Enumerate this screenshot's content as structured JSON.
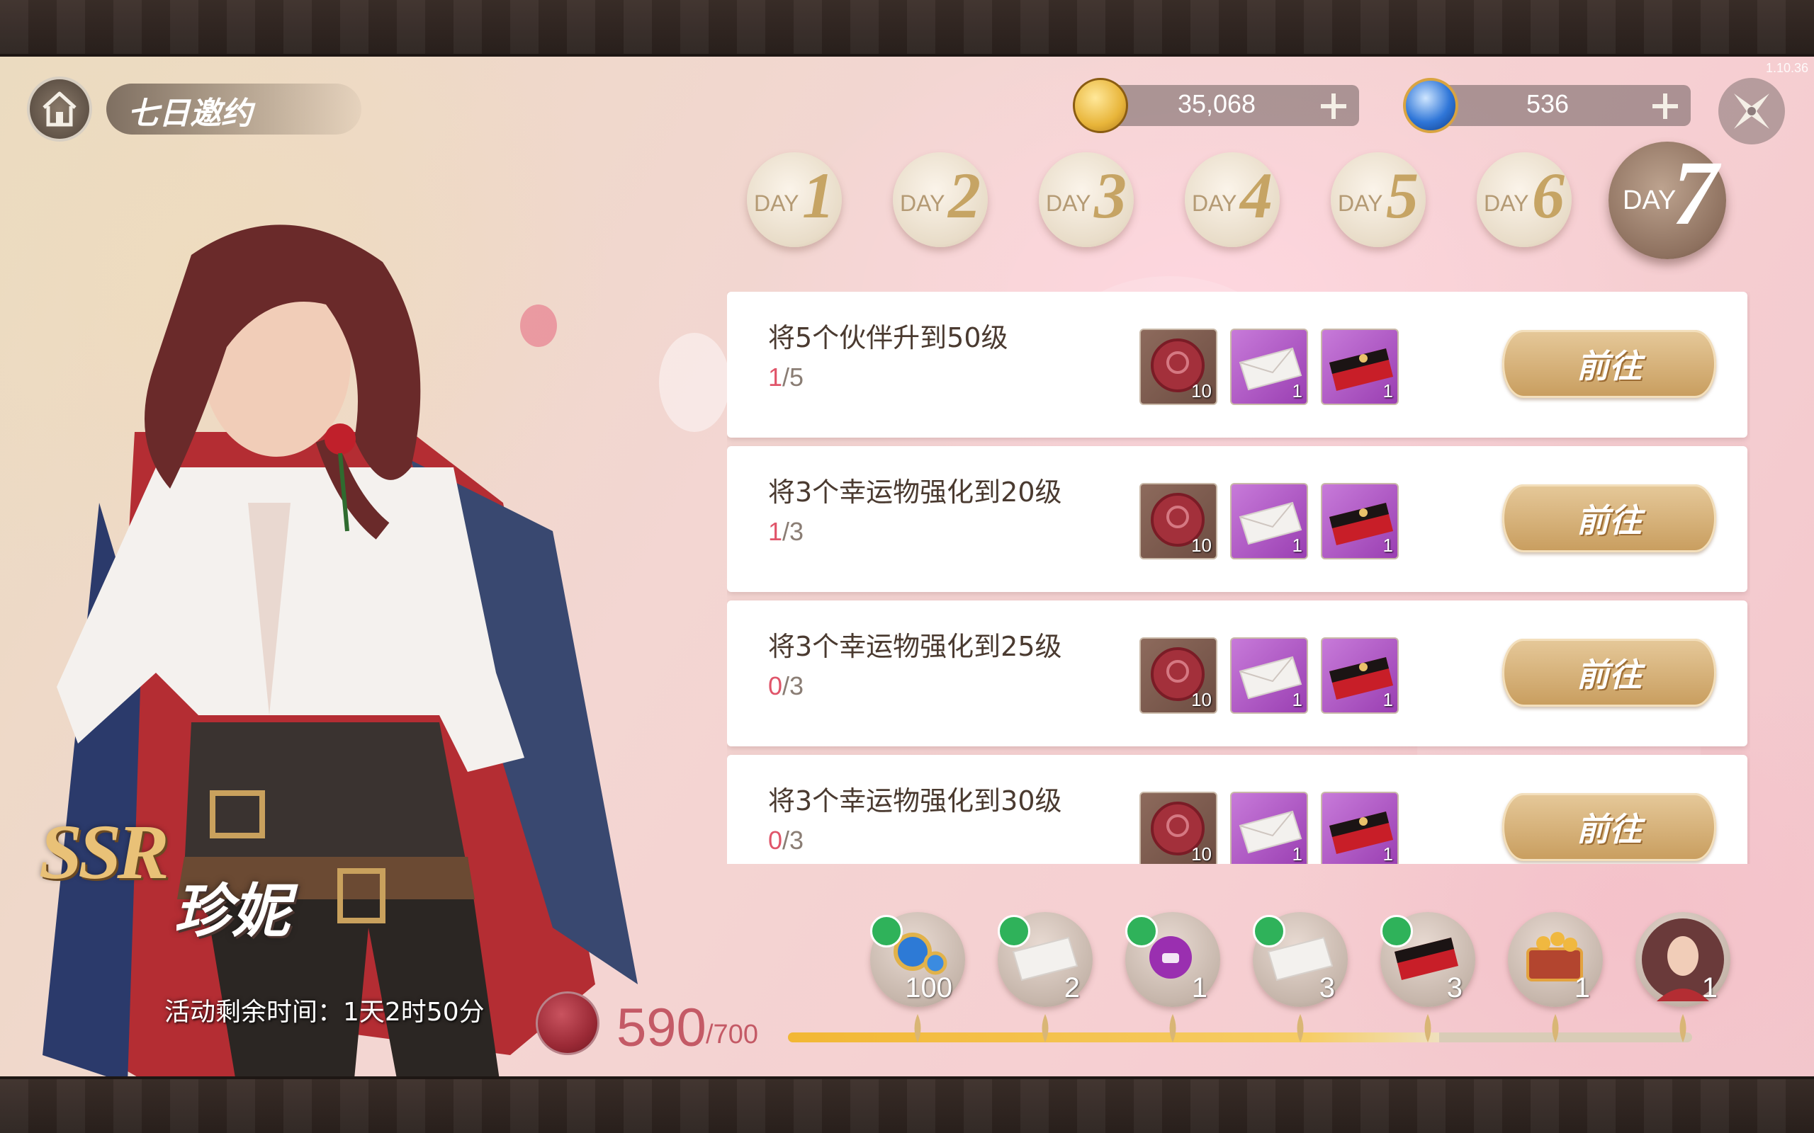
{
  "app": {
    "version": "1.10.36",
    "title": "七日邀约"
  },
  "currencies": [
    {
      "name": "gold-coin",
      "value": "35,068"
    },
    {
      "name": "blue-gem",
      "value": "536"
    }
  ],
  "days": [
    {
      "word": "DAY",
      "num": "1",
      "active": false
    },
    {
      "word": "DAY",
      "num": "2",
      "active": false
    },
    {
      "word": "DAY",
      "num": "3",
      "active": false
    },
    {
      "word": "DAY",
      "num": "4",
      "active": false
    },
    {
      "word": "DAY",
      "num": "5",
      "active": false
    },
    {
      "word": "DAY",
      "num": "6",
      "active": false
    },
    {
      "word": "DAY",
      "num": "7",
      "active": true
    }
  ],
  "tasks": [
    {
      "title": "将5个伙伴升到50级",
      "current": "1",
      "total": "/5",
      "rewards": [
        "10",
        "1",
        "1"
      ],
      "button": "前往"
    },
    {
      "title": "将3个幸运物强化到20级",
      "current": "1",
      "total": "/3",
      "rewards": [
        "10",
        "1",
        "1"
      ],
      "button": "前往"
    },
    {
      "title": "将3个幸运物强化到25级",
      "current": "0",
      "total": "/3",
      "rewards": [
        "10",
        "1",
        "1"
      ],
      "button": "前往"
    },
    {
      "title": "将3个幸运物强化到30级",
      "current": "0",
      "total": "/3",
      "rewards": [
        "10",
        "1",
        "1"
      ],
      "button": "前往"
    }
  ],
  "character": {
    "rarity": "SSR",
    "name": "珍妮"
  },
  "event": {
    "time_remaining": "活动剩余时间：1天2时50分",
    "points": "590",
    "points_max": "/700",
    "progress_fraction": 0.72
  },
  "milestones": [
    {
      "icon": "gem-rings-icon",
      "count": "100",
      "claimed": true
    },
    {
      "icon": "letter-icon",
      "count": "2",
      "claimed": true
    },
    {
      "icon": "purple-potion-icon",
      "count": "1",
      "claimed": true
    },
    {
      "icon": "letter-icon",
      "count": "3",
      "claimed": true
    },
    {
      "icon": "red-envelope-icon",
      "count": "3",
      "claimed": true
    },
    {
      "icon": "treasure-chest-icon",
      "count": "1",
      "claimed": false
    },
    {
      "icon": "character-portrait-icon",
      "count": "1",
      "claimed": false
    }
  ],
  "colors": {
    "accent_gold": "#c89d5e",
    "progress_red": "#e0556a",
    "points_red": "#c45a66",
    "progress_bar": "#f2b734"
  }
}
